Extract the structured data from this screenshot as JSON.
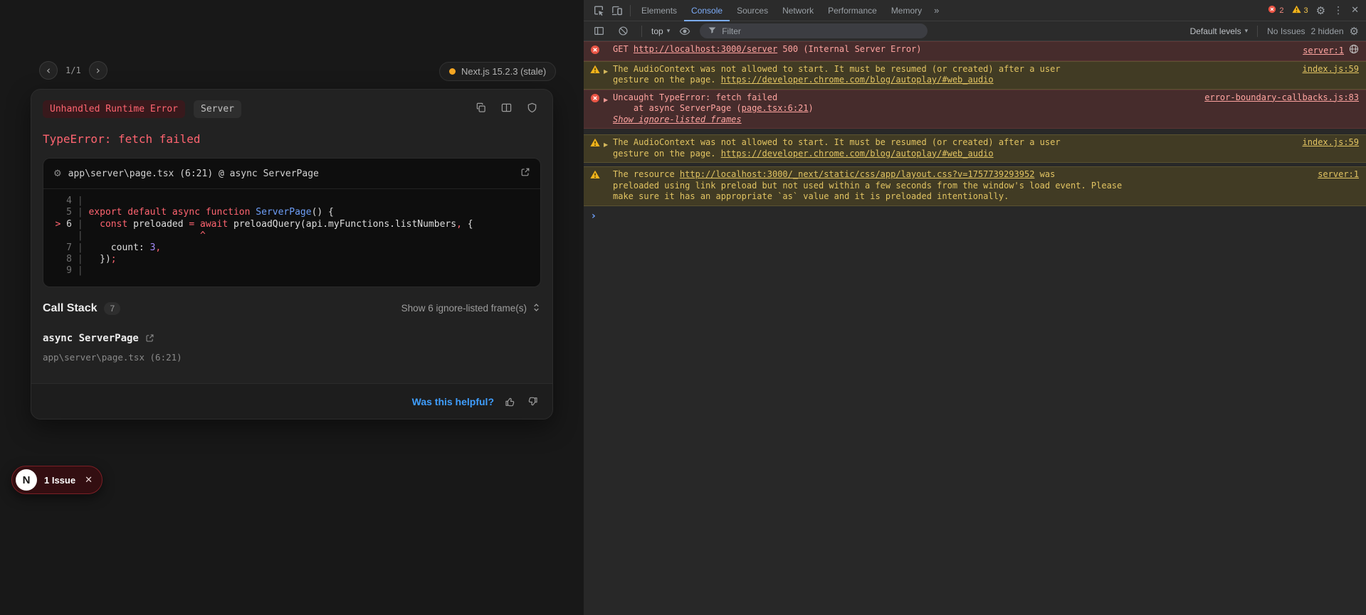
{
  "icons": {
    "chevron_left": "‹",
    "chevron_right": "›",
    "gear": "⚙",
    "kebab": "⋮",
    "close": "✕",
    "caret_down": "▾",
    "more_tabs": "»",
    "expand_triangle": "▶",
    "prompt": "›"
  },
  "overlay": {
    "pagination": {
      "current": "1/1"
    },
    "version": "Next.js 15.2.3 (stale)",
    "error_badge": "Unhandled Runtime Error",
    "env_badge": "Server",
    "title": "TypeError: fetch failed",
    "code_frame": {
      "header": "app\\server\\page.tsx (6:21) @ async ServerPage",
      "lines": [
        {
          "num": "4",
          "tokens": []
        },
        {
          "num": "5",
          "tokens": [
            {
              "t": "export default async function",
              "c": "kw"
            },
            {
              "t": " ",
              "c": "pl"
            },
            {
              "t": "ServerPage",
              "c": "fn"
            },
            {
              "t": "() {",
              "c": "pl"
            }
          ]
        },
        {
          "num": "6",
          "marked": true,
          "tokens": [
            {
              "t": "  ",
              "c": "pl"
            },
            {
              "t": "const",
              "c": "kw"
            },
            {
              "t": " preloaded ",
              "c": "pl"
            },
            {
              "t": "=",
              "c": "kw"
            },
            {
              "t": " ",
              "c": "pl"
            },
            {
              "t": "await",
              "c": "kw"
            },
            {
              "t": " ",
              "c": "pl"
            },
            {
              "t": "preloadQuery",
              "c": "pl"
            },
            {
              "t": "(api.myFunctions.listNumbers",
              "c": "pl"
            },
            {
              "t": ",",
              "c": "kw"
            },
            {
              "t": " {",
              "c": "pl"
            }
          ]
        },
        {
          "num": "",
          "tokens": [
            {
              "t": "                    ",
              "c": "pl"
            },
            {
              "t": "^",
              "c": "caret"
            }
          ]
        },
        {
          "num": "7",
          "tokens": [
            {
              "t": "    count: ",
              "c": "pl"
            },
            {
              "t": "3",
              "c": "num"
            },
            {
              "t": ",",
              "c": "kw"
            }
          ]
        },
        {
          "num": "8",
          "tokens": [
            {
              "t": "  })",
              "c": "pl"
            },
            {
              "t": ";",
              "c": "kw"
            }
          ]
        },
        {
          "num": "9",
          "tokens": []
        }
      ]
    },
    "call_stack": {
      "title": "Call Stack",
      "badge": "7",
      "toggle_label": "Show 6 ignore-listed frame(s)",
      "frame_name": "async ServerPage",
      "frame_location": "app\\server\\page.tsx (6:21)"
    },
    "footer": {
      "question": "Was this helpful?"
    },
    "issue_pill": {
      "logo_letter": "N",
      "label": "1 Issue"
    }
  },
  "devtools": {
    "tabs": [
      "Elements",
      "Console",
      "Sources",
      "Network",
      "Performance",
      "Memory"
    ],
    "active_tab": "Console",
    "error_count": "2",
    "warning_count": "3",
    "toolbar": {
      "context_selector": "top",
      "filter_placeholder": "Filter",
      "levels_dropdown": "Default levels",
      "no_issues_label": "No Issues",
      "hidden_label": "2 hidden"
    },
    "console": {
      "prompt": "›",
      "rows": [
        {
          "level": "error",
          "expandable": false,
          "globe": true,
          "source": "server:1",
          "lines": [
            [
              {
                "t": "GET ",
                "k": "text"
              },
              {
                "t": "http://localhost:3000/server",
                "k": "link"
              },
              {
                "t": " 500 (Internal Server Error)",
                "k": "text"
              }
            ]
          ]
        },
        {
          "level": "warning",
          "expandable": true,
          "globe": false,
          "source": "index.js:59",
          "lines": [
            [
              {
                "t": "The AudioContext was not allowed to start. It must be resumed (or created) after a user",
                "k": "text"
              }
            ],
            [
              {
                "t": "gesture on the page. ",
                "k": "text"
              },
              {
                "t": "https://developer.chrome.com/blog/autoplay/#web_audio",
                "k": "link"
              }
            ]
          ]
        },
        {
          "level": "error",
          "expandable": true,
          "globe": false,
          "source": "error-boundary-callbacks.js:83",
          "lines": [
            [
              {
                "t": "Uncaught TypeError: fetch failed",
                "k": "text"
              }
            ],
            [
              {
                "t": "    at async ServerPage (",
                "k": "text"
              },
              {
                "t": "page.tsx:6:21",
                "k": "link"
              },
              {
                "t": ")",
                "k": "text"
              }
            ],
            [
              {
                "t": "Show ignore-listed frames",
                "k": "ilink"
              }
            ]
          ]
        },
        {
          "level": "warning",
          "expandable": true,
          "globe": false,
          "source": "index.js:59",
          "lines": [
            [
              {
                "t": "The AudioContext was not allowed to start. It must be resumed (or created) after a user",
                "k": "text"
              }
            ],
            [
              {
                "t": "gesture on the page. ",
                "k": "text"
              },
              {
                "t": "https://developer.chrome.com/blog/autoplay/#web_audio",
                "k": "link"
              }
            ]
          ]
        },
        {
          "level": "warning",
          "expandable": false,
          "globe": false,
          "source": "server:1",
          "lines": [
            [
              {
                "t": "The resource ",
                "k": "text"
              },
              {
                "t": "http://localhost:3000/_next/static/css/app/layout.css?v=1757739293952",
                "k": "link"
              },
              {
                "t": " was",
                "k": "text"
              }
            ],
            [
              {
                "t": "preloaded using link preload but not used within a few seconds from the window's load event. Please",
                "k": "text"
              }
            ],
            [
              {
                "t": "make sure it has an appropriate `as` value and it is preloaded intentionally.",
                "k": "text"
              }
            ]
          ]
        }
      ]
    }
  }
}
